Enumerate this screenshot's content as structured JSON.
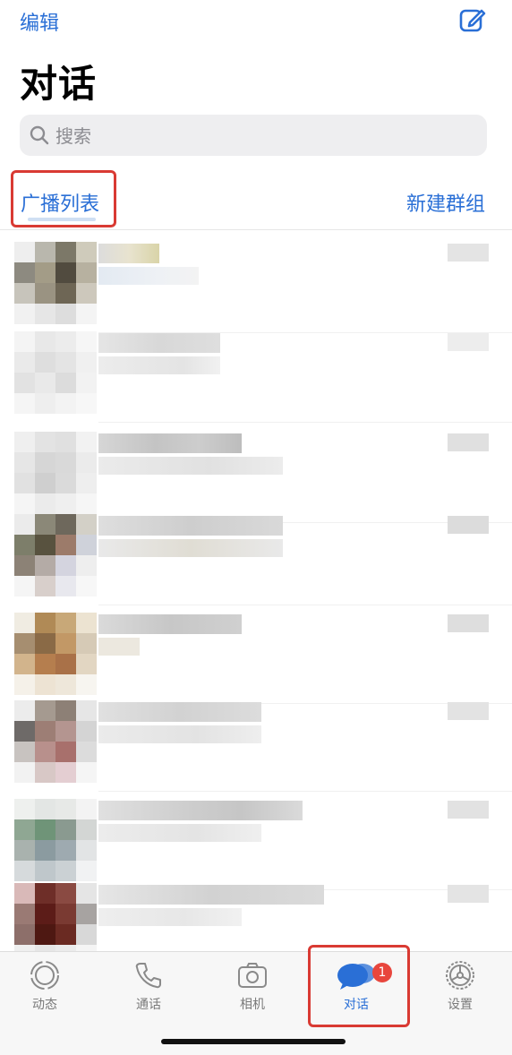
{
  "header": {
    "edit_label": "编辑",
    "title": "对话",
    "compose_icon": "compose-icon"
  },
  "search": {
    "placeholder": "搜索"
  },
  "actions": {
    "broadcast_label": "广播列表",
    "new_group_label": "新建群组"
  },
  "accent_color": "#2a6fd6",
  "highlight_color": "#d93a33",
  "conversations_note": "blurred",
  "tabs": [
    {
      "label": "动态",
      "icon": "status-icon"
    },
    {
      "label": "通话",
      "icon": "phone-icon"
    },
    {
      "label": "相机",
      "icon": "camera-icon"
    },
    {
      "label": "对话",
      "icon": "chat-bubbles-icon",
      "badge": "1",
      "active": true
    },
    {
      "label": "设置",
      "icon": "settings-icon"
    }
  ]
}
